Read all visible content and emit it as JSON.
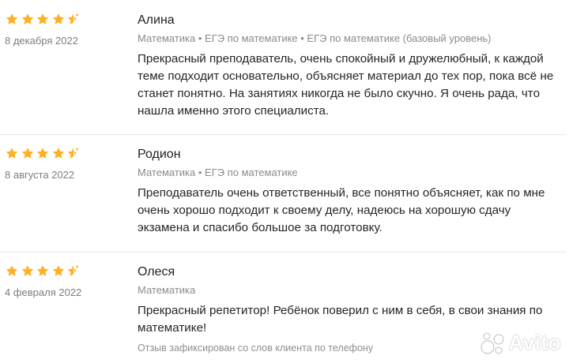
{
  "reviews": [
    {
      "author": "Алина",
      "date": "8 декабря 2022",
      "rating": 4.5,
      "categories": "Математика • ЕГЭ по математике • ЕГЭ по математике (базовый уровень)",
      "text": "Прекрасный преподаватель, очень спокойный и дружелюбный, к каждой теме подходит основательно, объясняет материал до тех пор, пока всё не станет понятно. На занятиях никогда не было скучно. Я очень рада, что нашла именно этого специалиста."
    },
    {
      "author": "Родион",
      "date": "8 августа 2022",
      "rating": 4.5,
      "categories": "Математика • ЕГЭ по математике",
      "text": "Преподаватель очень ответственный, все понятно объясняет, как по мне очень хорошо подходит к своему делу, надеюсь на хорошую сдачу экзамена и спасибо большое за подготовку."
    },
    {
      "author": "Олеся",
      "date": "4 февраля 2022",
      "rating": 4.5,
      "categories": "Математика",
      "text": "Прекрасный репетитор! Ребёнок поверил с ним в себя, в свои знания по математике!",
      "source_note": "Отзыв зафиксирован со слов клиента по телефону"
    }
  ],
  "watermark": {
    "text": "Avito"
  },
  "colors": {
    "star": "#ffb021",
    "text": "#262626",
    "muted": "#8a8a8a",
    "divider": "#e8e8e8"
  }
}
